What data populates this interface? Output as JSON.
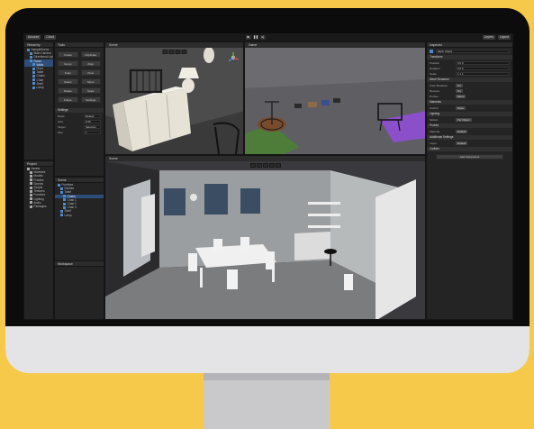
{
  "editor": {
    "toolbar": {
      "account_label": "Account",
      "cloud_label": "Cloud",
      "layers_label": "Layers",
      "layout_label": "Layout",
      "play_icon": "play-icon",
      "pause_icon": "pause-icon",
      "step_icon": "step-icon"
    },
    "hierarchy": {
      "tab": "Hierarchy",
      "items": [
        "SampleScene",
        "Main Camera",
        "Directional Light",
        "Room",
        "Walls",
        "Floor",
        "Table",
        "Chairs",
        "Chair",
        "Shelf",
        "Lamp"
      ]
    },
    "tools_panel": {
      "tab": "Tools",
      "buttons": [
        "Create",
        "Duplicate",
        "Group",
        "Align",
        "Snap",
        "Pivot",
        "Select",
        "Move",
        "Rotate",
        "Scale",
        "Frame",
        "Settings"
      ],
      "settings_header": "Settings",
      "fields": [
        {
          "label": "Mode",
          "value": "Default"
        },
        {
          "label": "Grid",
          "value": "0.25"
        },
        {
          "label": "Target",
          "value": "Selection"
        },
        {
          "label": "Size",
          "value": "1"
        }
      ]
    },
    "tree_panel": {
      "tab": "Scene",
      "items": [
        "Furniture",
        "Kitchen",
        "Table",
        "Chairs",
        "Chair 1",
        "Chair 2",
        "Chair 3",
        "Shelf",
        "Lamp"
      ],
      "footer": "Workspace"
    },
    "project": {
      "tab": "Project",
      "items": [
        "Assets",
        "Materials",
        "Models",
        "Prefabs",
        "Scenes",
        "Scripts",
        "Textures",
        "Furniture",
        "Lighting",
        "Audio",
        "Packages"
      ]
    },
    "scene_view": {
      "tab": "Scene"
    },
    "game_view": {
      "tab": "Game"
    },
    "inspector": {
      "tab": "Inspector",
      "object_name": "Mesh Object",
      "transform_header": "Transform",
      "transform_fields": [
        {
          "label": "Position",
          "value": "0    0    0"
        },
        {
          "label": "Rotation",
          "value": "0    0    0"
        },
        {
          "label": "Scale",
          "value": "1    1    1"
        }
      ],
      "sections": [
        "Mesh Renderer",
        "Materials",
        "Lighting",
        "Probes",
        "Additional Settings",
        "Collider"
      ],
      "fields": [
        {
          "label": "Cast Shadows",
          "value": "On"
        },
        {
          "label": "Receive",
          "value": "On"
        },
        {
          "label": "Probes",
          "value": "Blend"
        },
        {
          "label": "Anchor",
          "value": "None"
        },
        {
          "label": "Motion",
          "value": "Per Object"
        },
        {
          "label": "Material",
          "value": "Default"
        },
        {
          "label": "Layer",
          "value": "Default"
        }
      ],
      "add_component": "Add Component"
    },
    "colors": {
      "accent": "#2E4E79",
      "panel": "#242424",
      "toolbar": "#191919"
    }
  }
}
